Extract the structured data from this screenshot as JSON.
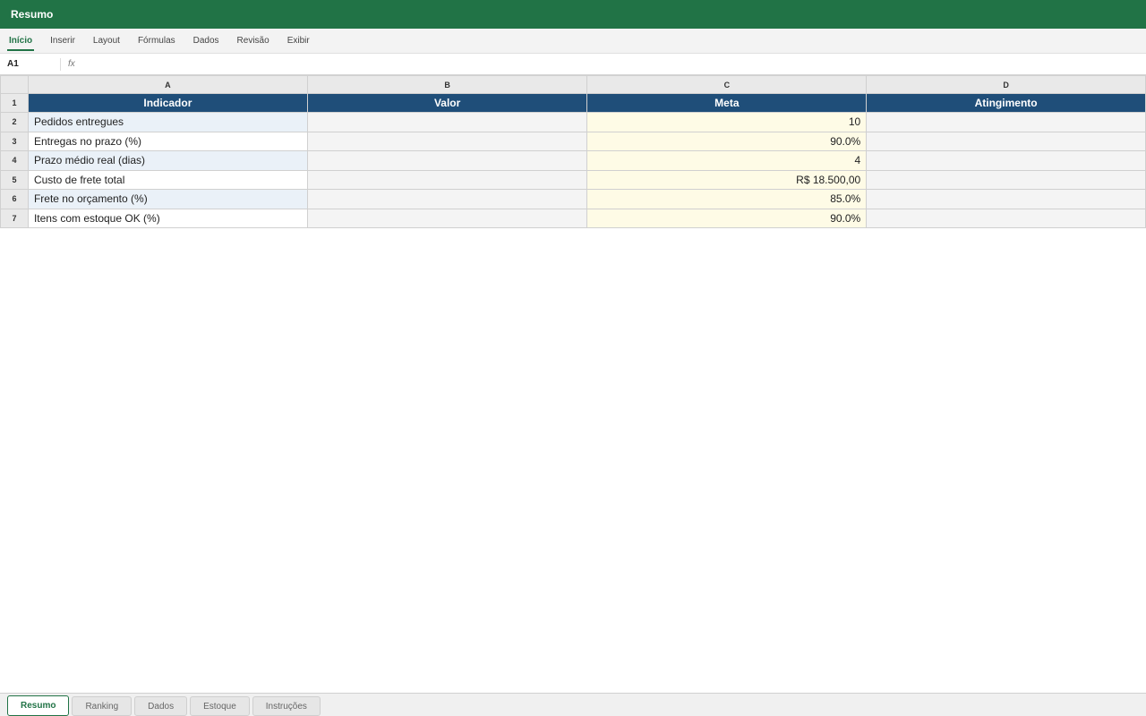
{
  "title": "Resumo",
  "ribbon": [
    "Início",
    "Inserir",
    "Layout",
    "Fórmulas",
    "Dados",
    "Revisão",
    "Exibir"
  ],
  "formula_bar": {
    "cell_ref": "A1",
    "fx": "fx",
    "value": ""
  },
  "columns": [
    "A",
    "B",
    "C",
    "D"
  ],
  "header_row": {
    "num": "1",
    "cells": [
      "Indicador",
      "Valor",
      "Meta",
      "Atingimento"
    ]
  },
  "rows": [
    {
      "num": "2",
      "indicador": "Pedidos entregues",
      "valor": "",
      "meta": "10",
      "atingimento": ""
    },
    {
      "num": "3",
      "indicador": "Entregas no prazo (%)",
      "valor": "",
      "meta": "90.0%",
      "atingimento": ""
    },
    {
      "num": "4",
      "indicador": "Prazo médio real (dias)",
      "valor": "",
      "meta": "4",
      "atingimento": ""
    },
    {
      "num": "5",
      "indicador": "Custo de frete total",
      "valor": "",
      "meta": "R$ 18.500,00",
      "atingimento": ""
    },
    {
      "num": "6",
      "indicador": "Frete no orçamento (%)",
      "valor": "",
      "meta": "85.0%",
      "atingimento": ""
    },
    {
      "num": "7",
      "indicador": "Itens com estoque OK (%)",
      "valor": "",
      "meta": "90.0%",
      "atingimento": ""
    }
  ],
  "sheet_tabs": [
    "Resumo",
    "Ranking",
    "Dados",
    "Estoque",
    "Instruções"
  ],
  "colors": {
    "brand": "#217346",
    "header_fill": "#1f4e79",
    "meta_fill": "#fefbe6",
    "alt_fill": "#eaf1f8"
  }
}
